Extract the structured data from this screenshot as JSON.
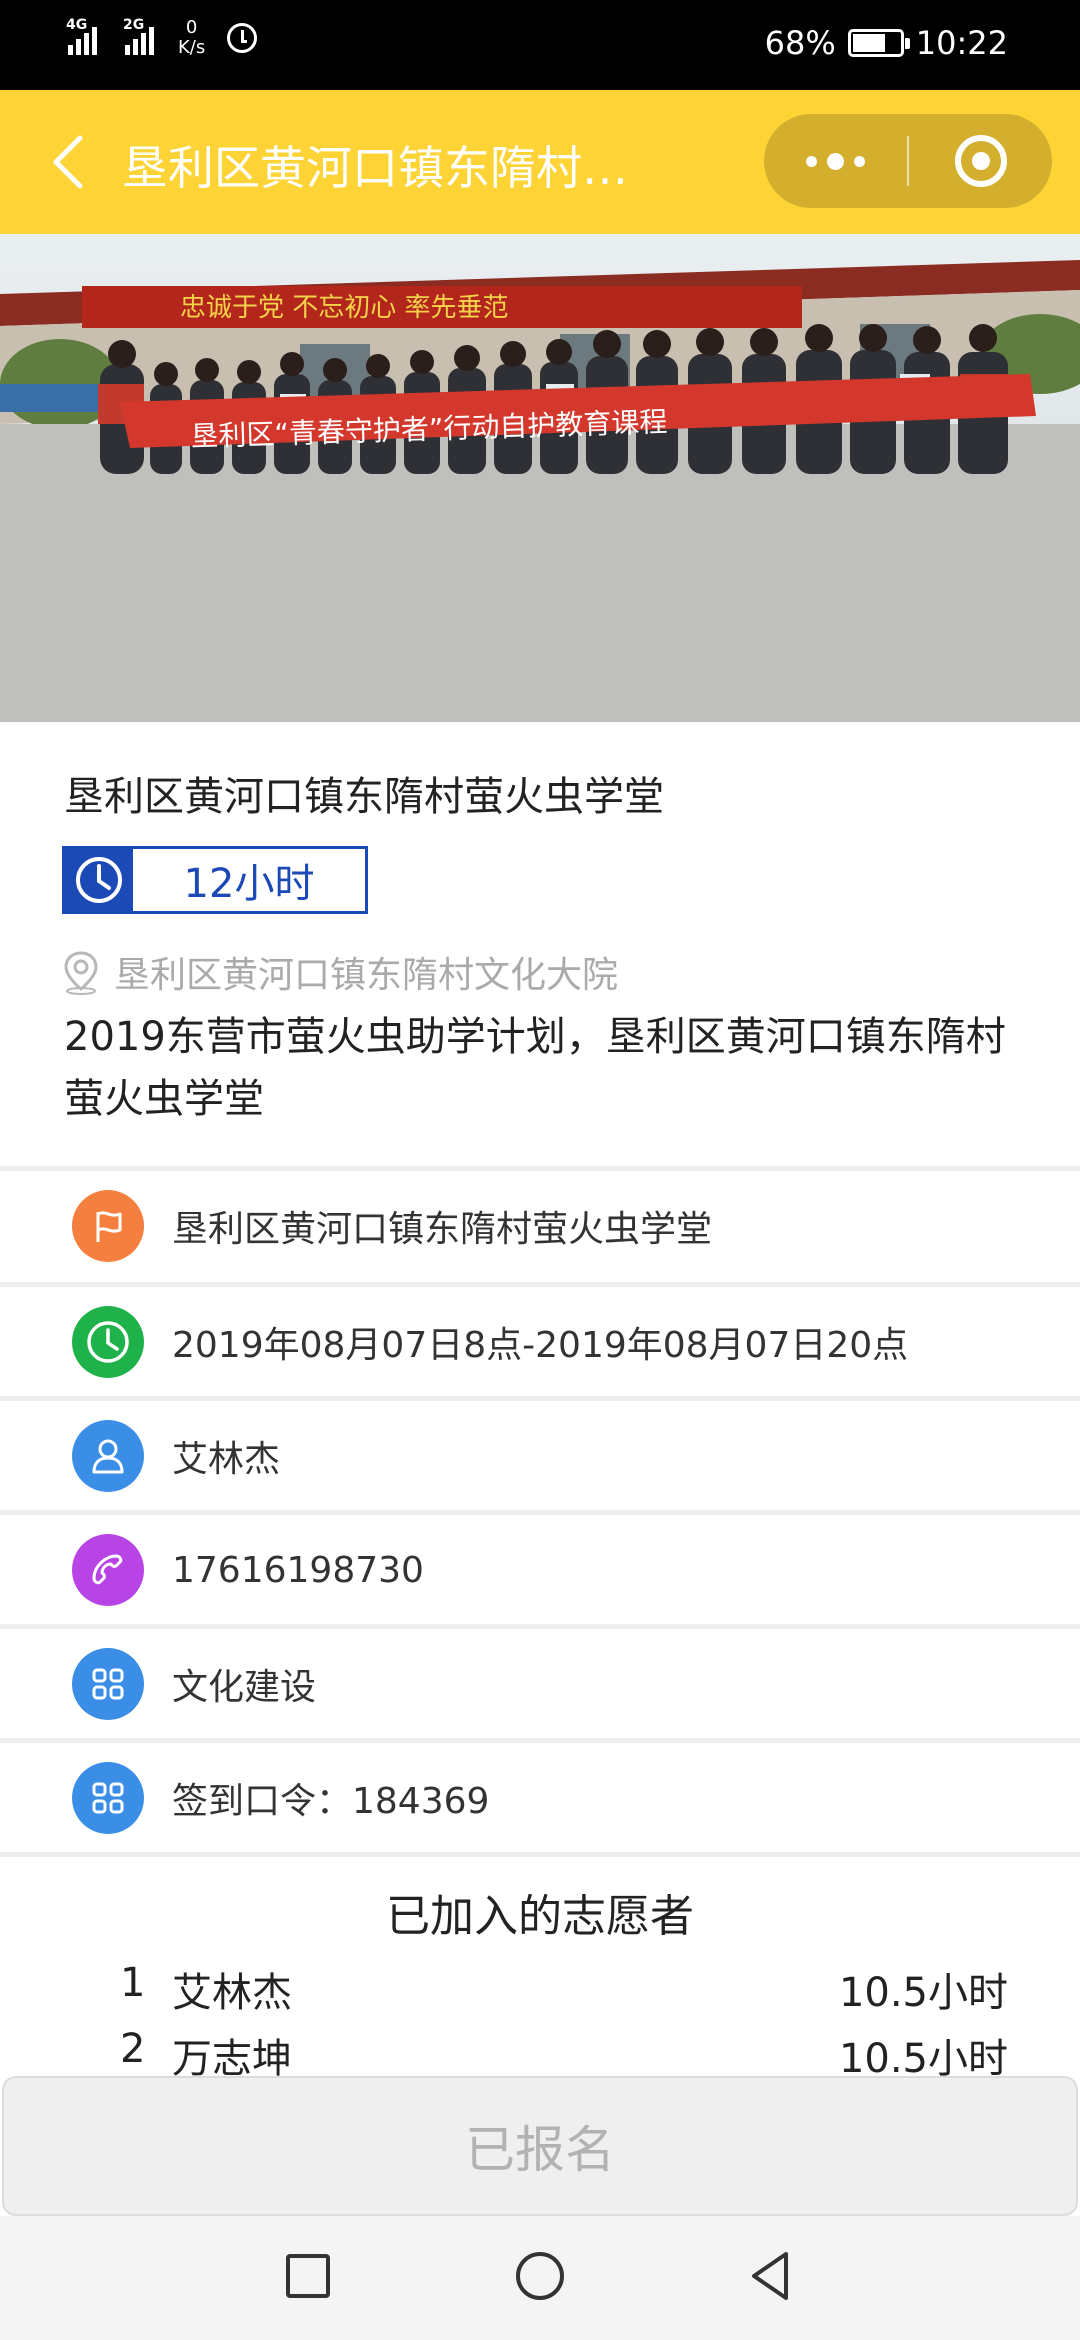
{
  "status_bar": {
    "signal1": "4G",
    "signal2": "2G",
    "net_speed_value": "0",
    "net_speed_unit": "K/s",
    "battery_percent": "68%",
    "time": "10:22"
  },
  "header": {
    "title": "垦利区黄河口镇东隋村…"
  },
  "banner": {
    "wall_slogan": "忠诚于党 不忘初心 率先垂范",
    "banner_text": "垦利区“青春守护者”行动自护教育课程"
  },
  "activity": {
    "title": "垦利区黄河口镇东隋村萤火虫学堂",
    "hours": "12小时",
    "location": "垦利区黄河口镇东隋村文化大院",
    "description": "2019东营市萤火虫助学计划，垦利区黄河口镇东隋村萤火虫学堂"
  },
  "details": [
    {
      "icon": "flag-icon",
      "color": "#f47f3f",
      "text": "垦利区黄河口镇东隋村萤火虫学堂"
    },
    {
      "icon": "clock-icon",
      "color": "#1fb24a",
      "text": "2019年08月07日8点-2019年08月07日20点"
    },
    {
      "icon": "person-icon",
      "color": "#3a8ee6",
      "text": "艾林杰"
    },
    {
      "icon": "phone-icon",
      "color": "#b844e6",
      "text": "17616198730"
    },
    {
      "icon": "grid-icon",
      "color": "#3a8ee6",
      "text": "文化建设"
    },
    {
      "icon": "grid-icon",
      "color": "#3a8ee6",
      "text": "签到口令：184369"
    }
  ],
  "volunteers": {
    "title": "已加入的志愿者",
    "list": [
      {
        "index": "1",
        "name": "艾林杰",
        "hours": "10.5小时"
      },
      {
        "index": "2",
        "name": "万志坤",
        "hours": "10.5小时"
      }
    ]
  },
  "signup_button": "已报名"
}
